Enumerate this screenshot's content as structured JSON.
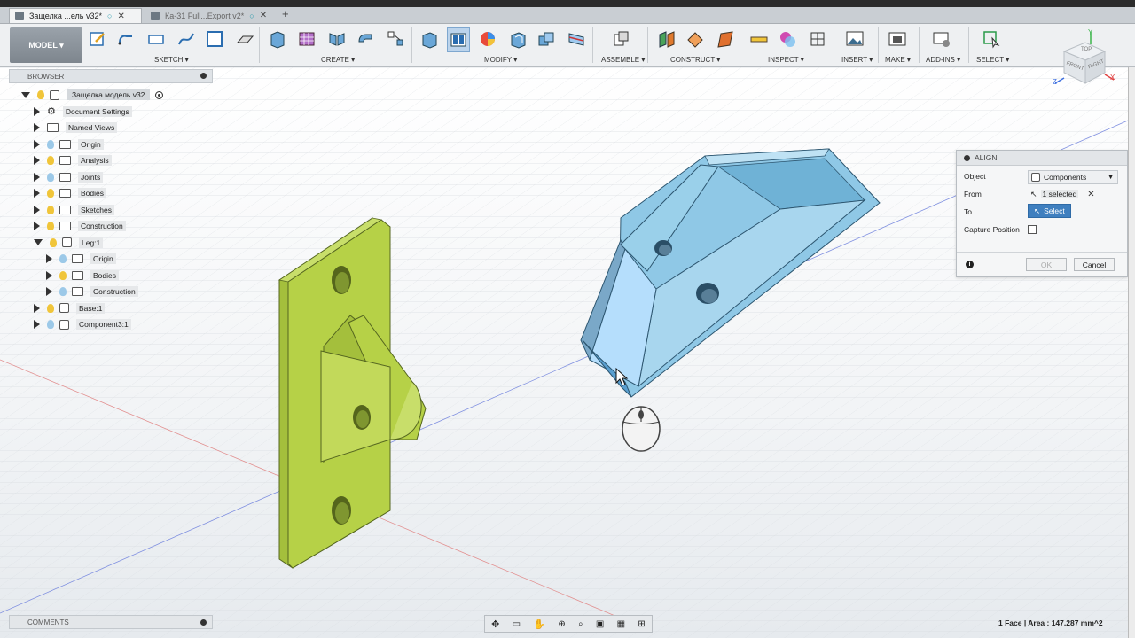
{
  "tabs": [
    {
      "title": "Защелка ...ель v32*",
      "active": true
    },
    {
      "title": "Ка-31 Full...Export v2*",
      "active": false
    }
  ],
  "new_tab_glyph": "+",
  "close_glyph": "✕",
  "ribbon": {
    "model_button": "MODEL ▾",
    "groups": [
      "SKETCH ▾",
      "CREATE ▾",
      "MODIFY ▾",
      "ASSEMBLE ▾",
      "CONSTRUCT ▾",
      "INSPECT ▾",
      "INSERT ▾",
      "MAKE ▾",
      "ADD-INS ▾",
      "SELECT ▾"
    ]
  },
  "browser": {
    "title": "BROWSER",
    "items": [
      {
        "label": "Защелка модель v32",
        "level": 0,
        "expanded": true,
        "icon": "document-icon",
        "bulb": true
      },
      {
        "label": "Document Settings",
        "level": 1,
        "expanded": false,
        "icon": "gear-icon",
        "bulb": false
      },
      {
        "label": "Named Views",
        "level": 1,
        "expanded": false,
        "icon": "folder-icon",
        "bulb": false
      },
      {
        "label": "Origin",
        "level": 1,
        "expanded": false,
        "icon": "folder-icon",
        "bulb": "off"
      },
      {
        "label": "Analysis",
        "level": 1,
        "expanded": false,
        "icon": "folder-icon",
        "bulb": "on"
      },
      {
        "label": "Joints",
        "level": 1,
        "expanded": false,
        "icon": "folder-icon",
        "bulb": "off"
      },
      {
        "label": "Bodies",
        "level": 1,
        "expanded": false,
        "icon": "folder-icon",
        "bulb": "on"
      },
      {
        "label": "Sketches",
        "level": 1,
        "expanded": false,
        "icon": "folder-icon",
        "bulb": "on"
      },
      {
        "label": "Construction",
        "level": 1,
        "expanded": false,
        "icon": "folder-icon",
        "bulb": "on"
      },
      {
        "label": "Leg:1",
        "level": 1,
        "expanded": true,
        "icon": "component-icon",
        "bulb": "on"
      },
      {
        "label": "Origin",
        "level": 2,
        "expanded": false,
        "icon": "folder-icon",
        "bulb": "off"
      },
      {
        "label": "Bodies",
        "level": 2,
        "expanded": false,
        "icon": "folder-icon",
        "bulb": "on"
      },
      {
        "label": "Construction",
        "level": 2,
        "expanded": false,
        "icon": "folder-icon",
        "bulb": "off"
      },
      {
        "label": "Base:1",
        "level": 1,
        "expanded": false,
        "icon": "component-icon",
        "bulb": "on"
      },
      {
        "label": "Component3:1",
        "level": 1,
        "expanded": false,
        "icon": "component-icon",
        "bulb": "off"
      }
    ]
  },
  "align": {
    "title": "ALIGN",
    "object_label": "Object",
    "object_value": "Components",
    "from_label": "From",
    "from_value": "1 selected",
    "to_label": "To",
    "to_value": "Select",
    "capture_label": "Capture Position",
    "ok": "OK",
    "cancel": "Cancel",
    "info_glyph": "i"
  },
  "comments": {
    "title": "COMMENTS"
  },
  "status": "1 Face | Area : 147.287 mm^2",
  "viewcube": {
    "faces": [
      "TOP",
      "FRONT",
      "RIGHT"
    ],
    "axes": [
      "Z",
      "X",
      "Y"
    ]
  },
  "colors": {
    "green_part": "#b6d147",
    "blue_part": "#8fc8e6",
    "select_blue": "#3f7fbf"
  }
}
